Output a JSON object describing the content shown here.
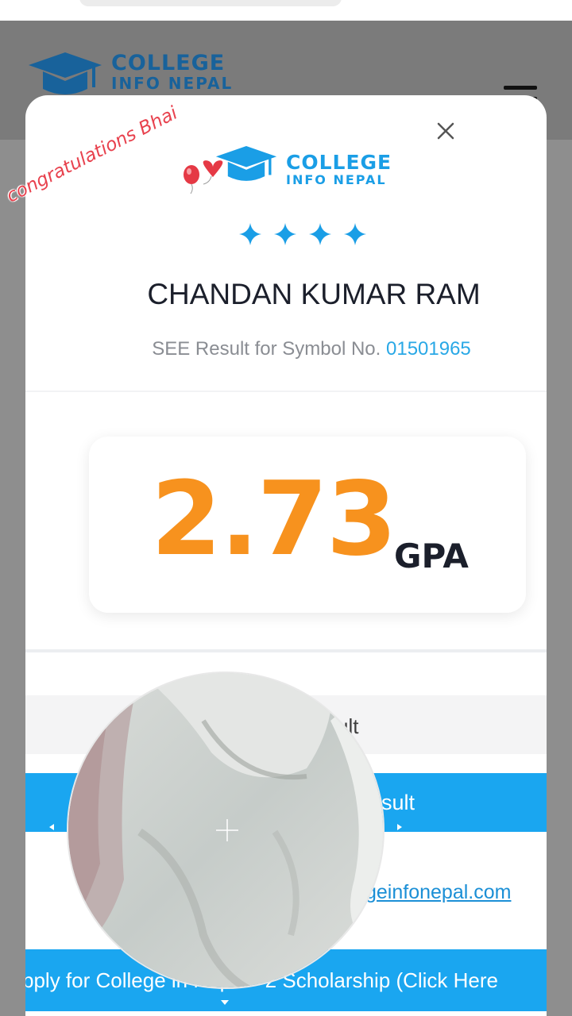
{
  "site": {
    "brand_line1": "COLLEGE",
    "brand_line2": "INFO NEPAL",
    "brand_color": "#1a9ee6",
    "menu_icon": "hamburger-icon"
  },
  "modal": {
    "brand_line1": "COLLEGE",
    "brand_line2": "INFO NEPAL",
    "close_icon": "close-icon",
    "star_icons": [
      "star-icon",
      "star-icon",
      "star-icon",
      "star-icon"
    ],
    "student_name": "CHANDAN KUMAR RAM",
    "symbol_prefix": "SEE Result for Symbol No.",
    "symbol_number": "01501965",
    "gpa": {
      "value": "2.73",
      "unit": "GPA",
      "color": "#f7921e"
    },
    "grey_row_partial": "ult",
    "blue_button_partial": "sult",
    "link_partial": "geinfonepal.com",
    "scholarship_button": "pply for College in Nepal +2 Scholarship (Click Here"
  },
  "overlay": {
    "sticker_text": "congratulations Bhai",
    "sticker_color": "#e8424e",
    "sticker_emoji": "balloon-heart-icons",
    "magnifier": "magnifier-lens-icon"
  }
}
